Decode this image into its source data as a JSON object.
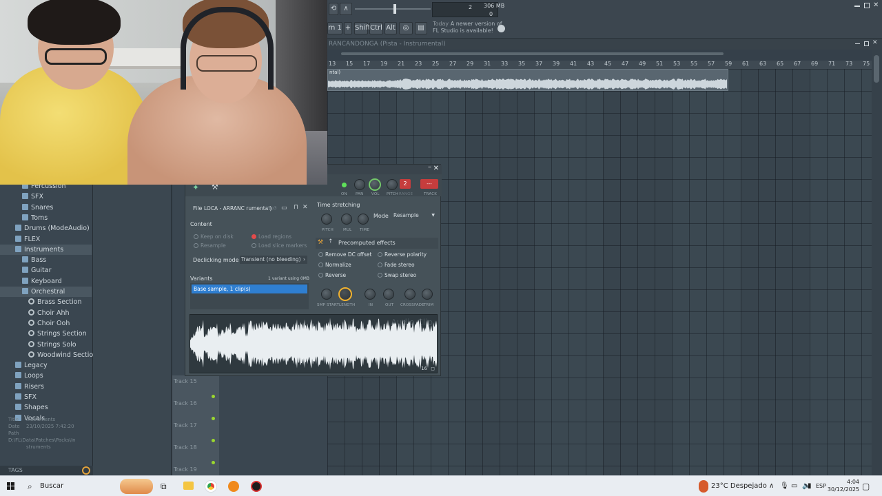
{
  "topbar": {
    "pattern_button": "rn 1",
    "shift": "Shift",
    "ctrl": "Ctrl",
    "alt": "Alt",
    "cpu_value": "2",
    "memory": "306 MB",
    "polyphony": "0",
    "news_today": "Today",
    "news_text_1": "A newer version of",
    "news_text_2": "FL Studio is available!"
  },
  "playlist": {
    "title": "RANCANDONGA (Pista - Instrumental)",
    "clip_label": "ntal)",
    "ruler": [
      "13",
      "15",
      "17",
      "19",
      "21",
      "23",
      "25",
      "27",
      "29",
      "31",
      "33",
      "35",
      "37",
      "39",
      "41",
      "43",
      "45",
      "47",
      "49",
      "51",
      "53",
      "55",
      "57",
      "59",
      "61",
      "63",
      "65",
      "67",
      "69",
      "71",
      "73",
      "75"
    ],
    "tracks": [
      "Track 15",
      "Track 16",
      "Track 17",
      "Track 18",
      "Track 19"
    ]
  },
  "browser": {
    "items": [
      {
        "label": "Percussion",
        "level": 2,
        "icon": "folder-icon"
      },
      {
        "label": "SFX",
        "level": 2,
        "icon": "folder-icon"
      },
      {
        "label": "Snares",
        "level": 2,
        "icon": "folder-icon"
      },
      {
        "label": "Toms",
        "level": 2,
        "icon": "folder-icon"
      },
      {
        "label": "Drums (ModeAudio)",
        "level": 1,
        "icon": "folder-icon"
      },
      {
        "label": "FLEX",
        "level": 1,
        "icon": "folder-icon"
      },
      {
        "label": "Instruments",
        "level": 1,
        "icon": "folder-icon",
        "selected": true
      },
      {
        "label": "Bass",
        "level": 2,
        "icon": "folder-icon"
      },
      {
        "label": "Guitar",
        "level": 2,
        "icon": "folder-icon"
      },
      {
        "label": "Keyboard",
        "level": 2,
        "icon": "folder-icon"
      },
      {
        "label": "Orchestral",
        "level": 2,
        "icon": "folder-icon",
        "selected": true
      },
      {
        "label": "Brass Section",
        "level": 3,
        "icon": "gear-icon"
      },
      {
        "label": "Choir Ahh",
        "level": 3,
        "icon": "gear-icon"
      },
      {
        "label": "Choir Ooh",
        "level": 3,
        "icon": "gear-icon"
      },
      {
        "label": "Strings Section",
        "level": 3,
        "icon": "gear-icon"
      },
      {
        "label": "Strings Solo",
        "level": 3,
        "icon": "gear-icon"
      },
      {
        "label": "Woodwind Section",
        "level": 3,
        "icon": "gear-icon"
      },
      {
        "label": "Legacy",
        "level": 1,
        "icon": "folder-icon"
      },
      {
        "label": "Loops",
        "level": 1,
        "icon": "folder-icon"
      },
      {
        "label": "Risers",
        "level": 1,
        "icon": "folder-icon"
      },
      {
        "label": "SFX",
        "level": 1,
        "icon": "folder-icon"
      },
      {
        "label": "Shapes",
        "level": 1,
        "icon": "folder-icon"
      },
      {
        "label": "Vocals",
        "level": 1,
        "icon": "folder-icon"
      }
    ],
    "info": {
      "title_key": "Title",
      "title_val": "Instruments",
      "date_key": "Date",
      "date_val": "23/10/2025 7:42:20",
      "path_key": "Path",
      "path_val": "D:\\FL\\Data\\Patches\\Packs\\In",
      "path_val2": "struments"
    },
    "tags_label": "TAGS"
  },
  "clip_window": {
    "knob_labels": {
      "on": "ON",
      "pan": "PAN",
      "vol": "VOL",
      "pitch": "PITCH",
      "range": "RANGE",
      "track": "TRACK"
    },
    "pitch_value": "2",
    "track_value": "---",
    "file_label": "File",
    "file_name": "LOCA - ARRANC  rumental)",
    "file_ext": ".mp3",
    "content_label": "Content",
    "keep_on_disk": "Keep on disk",
    "resample": "Resample",
    "load_regions": "Load regions",
    "load_slice_markers": "Load slice markers",
    "declicking_label": "Declicking mode",
    "declicking_value": "Transient (no bleeding)",
    "variants_label": "Variants",
    "variants_info": "1 variant using 0MB",
    "variant_item": "Base sample, 1 clip(s)",
    "time_stretching": "Time stretching",
    "ts_knobs": [
      "PITCH",
      "MUL",
      "TIME"
    ],
    "mode_label": "Mode",
    "mode_value": "Resample",
    "precomputed": "Precomputed effects",
    "effects": [
      "Remove DC offset",
      "Reverse polarity",
      "Normalize",
      "Fade stereo",
      "Reverse",
      "Swap stereo"
    ],
    "bottom_knobs": [
      "SMP START",
      "LENGTH",
      "IN",
      "OUT",
      "CROSSFADE",
      "TRIM"
    ],
    "watermark": "Audio Clip",
    "wave_zoom": "16"
  },
  "taskbar": {
    "search": "Buscar",
    "weather": "23°C  Despejado",
    "language": "ESP",
    "time": "4:04",
    "date": "30/12/2025"
  }
}
